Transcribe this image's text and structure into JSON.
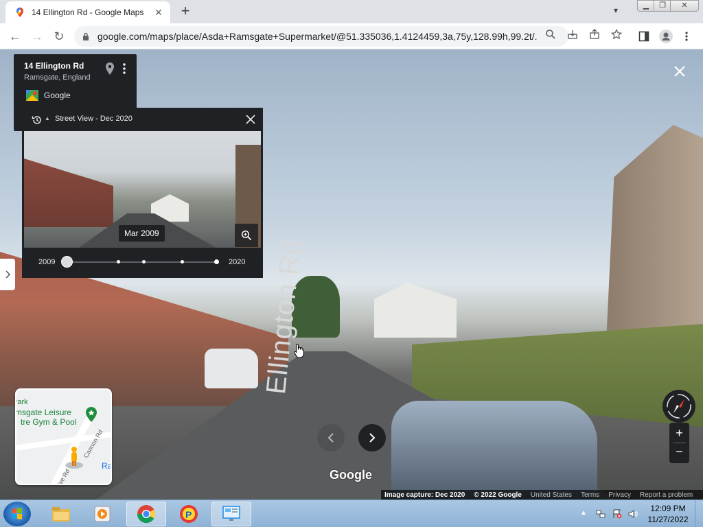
{
  "browser": {
    "tab_title": "14 Ellington Rd - Google Maps",
    "url": "google.com/maps/place/Asda+Ramsgate+Supermarket/@51.335036,1.4124459,3a,75y,128.99h,99.2t/..."
  },
  "info_card": {
    "title": "14 Ellington Rd",
    "subtitle": "Ramsgate, England",
    "source": "Google"
  },
  "time_travel": {
    "label": "Street View - Dec 2020",
    "tooltip": "Mar 2009",
    "year_start": "2009",
    "year_end": "2020"
  },
  "scene": {
    "road_name": "Ellington Rd",
    "watermark": "Google"
  },
  "mini_map": {
    "place_line1": "Park",
    "place_line2": "msgate Leisure",
    "place_line3": "tre Gym & Pool",
    "road_1": "Cannon Rd",
    "road_2": "ive Rd",
    "label_right": "Ra"
  },
  "attribution": {
    "capture": "Image capture: Dec 2020",
    "copyright": "© 2022 Google",
    "region": "United States",
    "terms": "Terms",
    "privacy": "Privacy",
    "report": "Report a problem"
  },
  "taskbar": {
    "time": "12:09 PM",
    "date": "11/27/2022"
  },
  "colors": {
    "panel_dark": "#202124",
    "map_pin_green": "#188038",
    "accent_blue": "#1a73e8"
  }
}
